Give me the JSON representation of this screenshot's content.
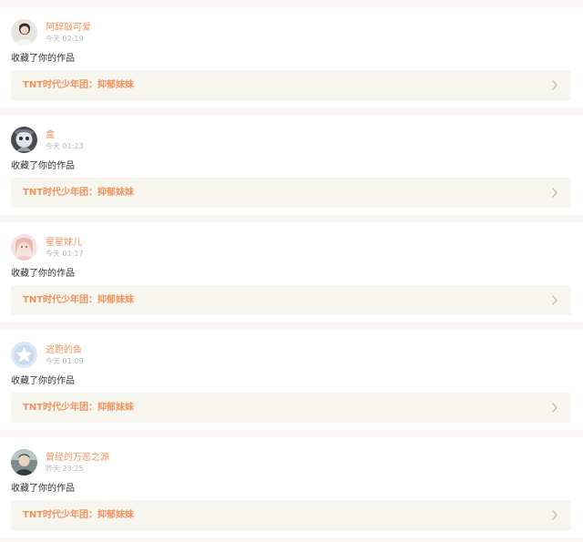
{
  "colors": {
    "accent": "#f0925e",
    "link_bg": "#f7f6ee",
    "page_bg": "#fbf6f6",
    "time": "#b8b8b8"
  },
  "notifications": [
    {
      "user": "阿辞敲可爱",
      "time": "今天 02:19",
      "action": "收藏了你的作品",
      "work_title": "TNT时代少年团：抑郁妹妹",
      "avatar_icon": "user-photo"
    },
    {
      "user": "盒",
      "time": "今天 01:23",
      "action": "收藏了你的作品",
      "work_title": "TNT时代少年团：抑郁妹妹",
      "avatar_icon": "user-photo"
    },
    {
      "user": "星星妹儿",
      "time": "今天 01:17",
      "action": "收藏了你的作品",
      "work_title": "TNT时代少年团：抑郁妹妹",
      "avatar_icon": "user-photo"
    },
    {
      "user": "逃跑的鱼",
      "time": "今天 01:09",
      "action": "收藏了你的作品",
      "work_title": "TNT时代少年团：抑郁妹妹",
      "avatar_icon": "star-icon"
    },
    {
      "user": "曾经的万恶之源",
      "time": "昨天 23:25",
      "action": "收藏了你的作品",
      "work_title": "TNT时代少年团：抑郁妹妹",
      "avatar_icon": "user-photo"
    }
  ]
}
